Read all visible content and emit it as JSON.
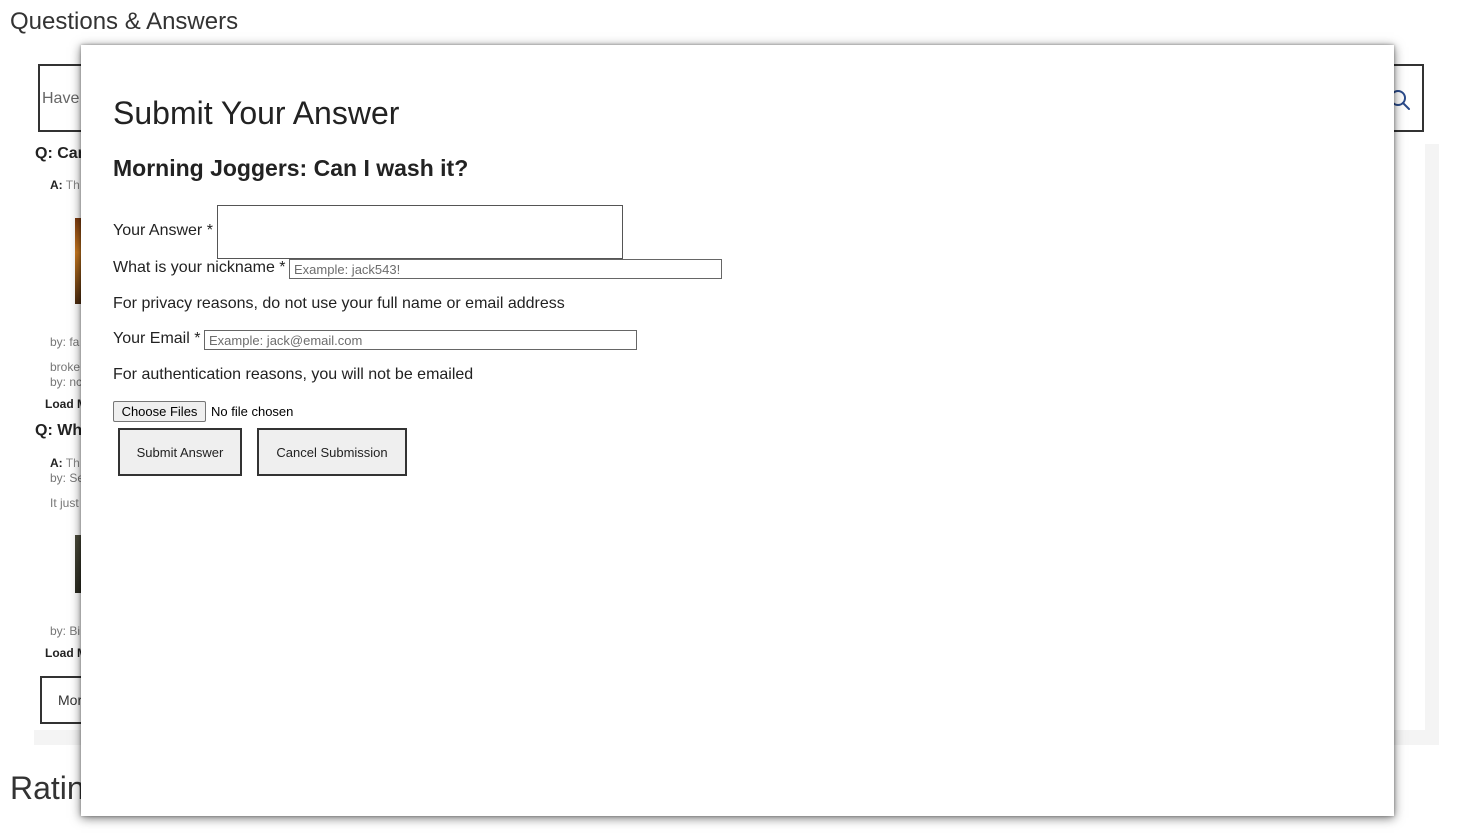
{
  "background": {
    "qa_title": "Questions & Answers",
    "search_placeholder": "Have a question? Search for answers...",
    "q1": "Q: Can",
    "q1_answer_prefix": "A:",
    "q1_answer_text": "Th",
    "q1_by": "by: fa",
    "q1_extra_line1": "broke",
    "q1_extra_line2": "by: nc",
    "load_more_1": "Load M",
    "q2": "Q: Wh",
    "q2_answer_prefix": "A:",
    "q2_answer_text": "Th",
    "q2_by": "by: Se",
    "q2_extra": "It just",
    "q2_by2": "by: Bi",
    "load_more_2": "Load M",
    "more_button": "Mor",
    "ratings_title": "Ratin"
  },
  "modal": {
    "title": "Submit Your Answer",
    "subtitle": "Morning Joggers: Can I wash it?",
    "answer_label": "Your Answer *",
    "nickname_label": "What is your nickname *",
    "nickname_placeholder": "Example: jack543!",
    "privacy_note": "For privacy reasons, do not use your full name or email address",
    "email_label": "Your Email *",
    "email_placeholder": "Example: jack@email.com",
    "auth_note": "For authentication reasons, you will not be emailed",
    "choose_files_label": "Choose Files",
    "file_status": "No file chosen",
    "submit_label": "Submit Answer",
    "cancel_label": "Cancel Submission"
  },
  "colors": {
    "search_icon": "#2a4a8a",
    "modal_background": "#ffffff"
  },
  "icons": {
    "search": "search-icon"
  }
}
